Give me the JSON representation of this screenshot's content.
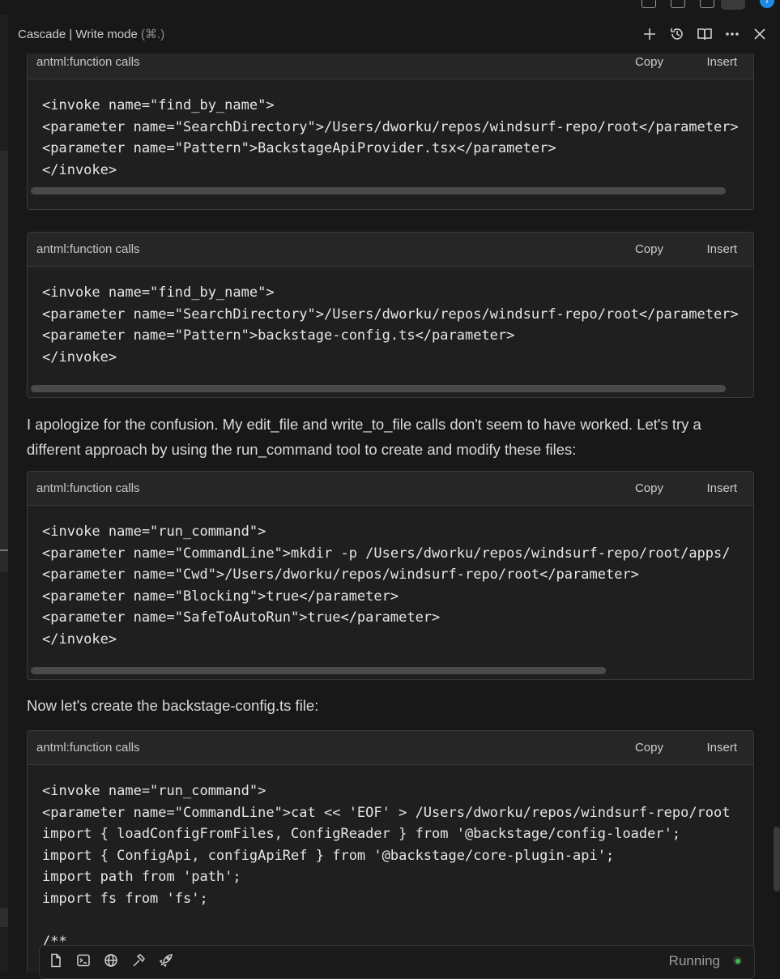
{
  "header": {
    "title": "Cascade | Write mode",
    "shortcut": "(⌘.)"
  },
  "blocks": [
    {
      "lang": "antml:function calls",
      "copy": "Copy",
      "insert": "Insert",
      "code": "<invoke name=\"find_by_name\">\n<parameter name=\"SearchDirectory\">/Users/dworku/repos/windsurf-repo/root</parameter>\n<parameter name=\"Pattern\">BackstageApiProvider.tsx</parameter>\n</invoke>"
    },
    {
      "lang": "antml:function calls",
      "copy": "Copy",
      "insert": "Insert",
      "code": "<invoke name=\"find_by_name\">\n<parameter name=\"SearchDirectory\">/Users/dworku/repos/windsurf-repo/root</parameter>\n<parameter name=\"Pattern\">backstage-config.ts</parameter>\n</invoke>"
    },
    {
      "lang": "antml:function calls",
      "copy": "Copy",
      "insert": "Insert",
      "code": "<invoke name=\"run_command\">\n<parameter name=\"CommandLine\">mkdir -p /Users/dworku/repos/windsurf-repo/root/apps/\n<parameter name=\"Cwd\">/Users/dworku/repos/windsurf-repo/root</parameter>\n<parameter name=\"Blocking\">true</parameter>\n<parameter name=\"SafeToAutoRun\">true</parameter>\n</invoke>"
    },
    {
      "lang": "antml:function calls",
      "copy": "Copy",
      "insert": "Insert",
      "code": "<invoke name=\"run_command\">\n<parameter name=\"CommandLine\">cat << 'EOF' > /Users/dworku/repos/windsurf-repo/root\nimport { loadConfigFromFiles, ConfigReader } from '@backstage/config-loader';\nimport { ConfigApi, configApiRef } from '@backstage/core-plugin-api';\nimport path from 'path';\nimport fs from 'fs';\n\n/**"
    }
  ],
  "messages": {
    "apology": "I apologize for the confusion. My edit_file and write_to_file calls don't seem to have worked. Let's try a different approach by using the run_command tool to create and modify these files:",
    "next": "Now let's create the backstage-config.ts file:"
  },
  "bottom": {
    "status": "Running",
    "tools": [
      "file-icon",
      "terminal-icon",
      "globe-icon",
      "hammer-icon",
      "rocket-icon"
    ]
  },
  "colors": {
    "background": "#181818",
    "block_header": "#262626",
    "status_dot": "#3fb950"
  }
}
